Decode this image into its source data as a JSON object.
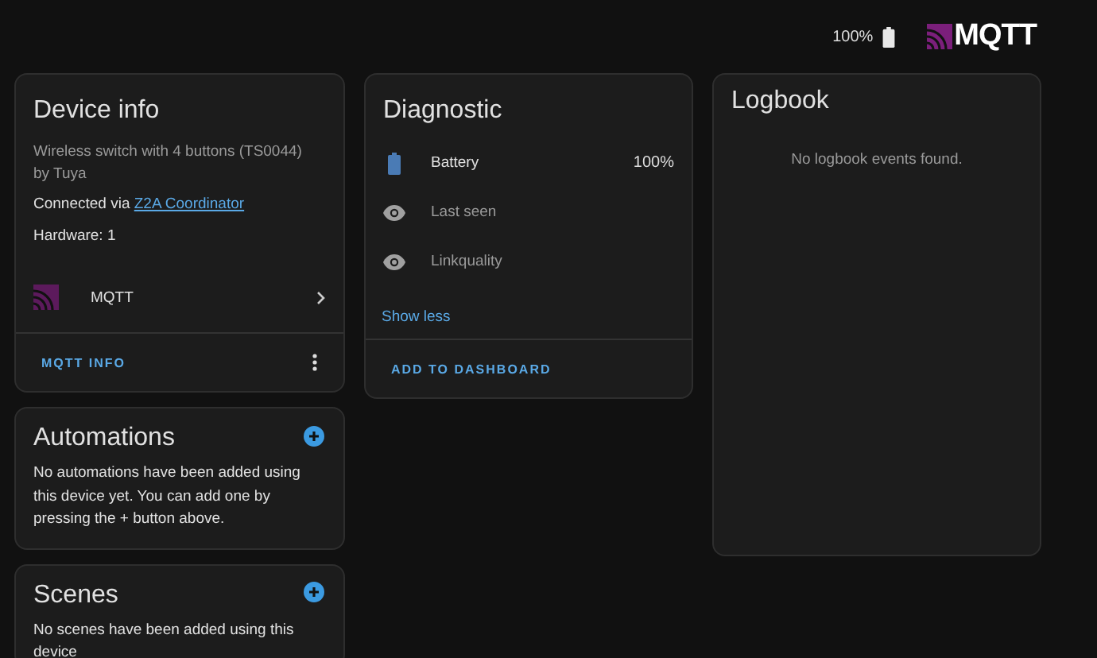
{
  "header": {
    "battery": "100%",
    "logo": "MQTT"
  },
  "device_info": {
    "title": "Device info",
    "model": "Wireless switch with 4 buttons (TS0044)",
    "manufacturer": "by Tuya",
    "connected_prefix": "Connected via",
    "connected_link": "Z2A Coordinator",
    "hardware": "Hardware: 1",
    "integration": "MQTT",
    "action": "MQTT INFO"
  },
  "automations": {
    "title": "Automations",
    "text": "No automations have been added using this device yet. You can add one by pressing the + button above."
  },
  "scenes": {
    "title": "Scenes",
    "text": "No scenes have been added using this device"
  },
  "diagnostic": {
    "title": "Diagnostic",
    "entities": [
      {
        "kind": "battery",
        "name": "Battery",
        "value": "100%"
      },
      {
        "kind": "eye",
        "name": "Last seen"
      },
      {
        "kind": "eye",
        "name": "Linkquality"
      }
    ],
    "toggle": "Show less",
    "action": "ADD TO DASHBOARD"
  },
  "logbook": {
    "title": "Logbook",
    "empty": "No logbook events found."
  }
}
